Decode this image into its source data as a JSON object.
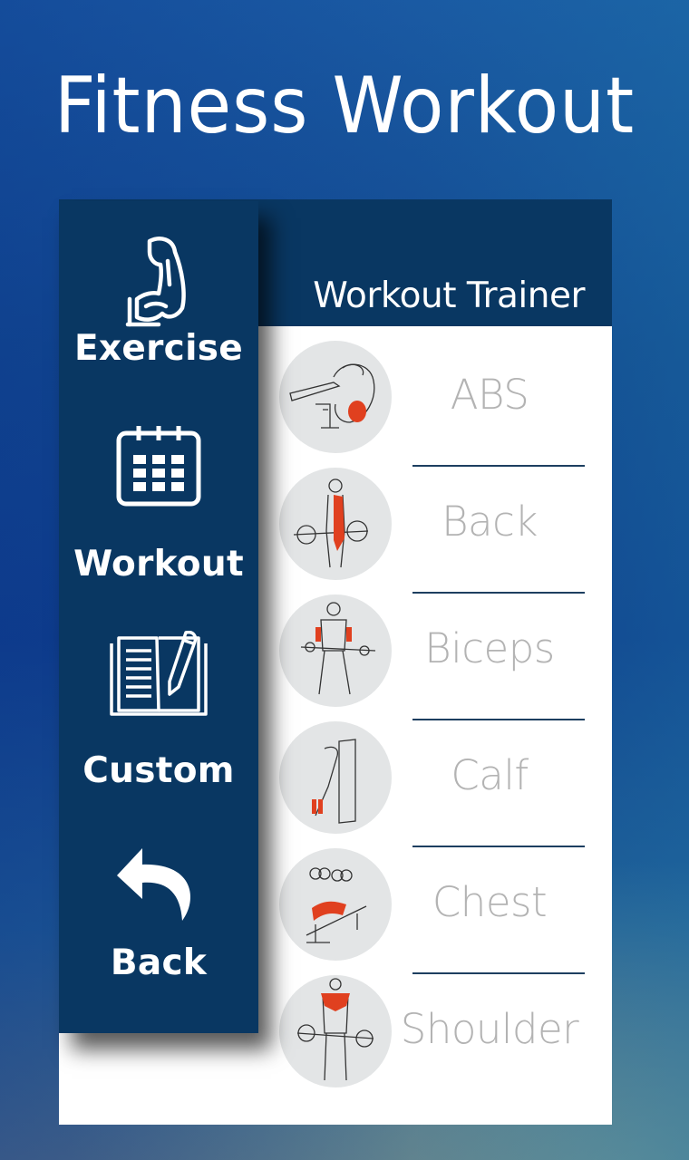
{
  "app": {
    "title": "Fitness Workout"
  },
  "header": {
    "title": "Workout Trainer"
  },
  "sidebar": {
    "items": [
      {
        "label": "Exercise",
        "icon": "flexed-bicep-icon"
      },
      {
        "label": "Workout",
        "icon": "calendar-icon"
      },
      {
        "label": "Custom",
        "icon": "notebook-pencil-icon"
      },
      {
        "label": "Back",
        "icon": "back-arrow-icon"
      }
    ]
  },
  "muscle_groups": [
    {
      "label": "ABS",
      "image": "abs-exercise-illustration"
    },
    {
      "label": "Back",
      "image": "back-exercise-illustration"
    },
    {
      "label": "Biceps",
      "image": "biceps-exercise-illustration"
    },
    {
      "label": "Calf",
      "image": "calf-exercise-illustration"
    },
    {
      "label": "Chest",
      "image": "chest-exercise-illustration"
    },
    {
      "label": "Shoulder",
      "image": "shoulder-exercise-illustration"
    }
  ],
  "colors": {
    "navy": "#093762",
    "highlight_muscle": "#e0401f",
    "label_gray": "#b3b3b3"
  }
}
